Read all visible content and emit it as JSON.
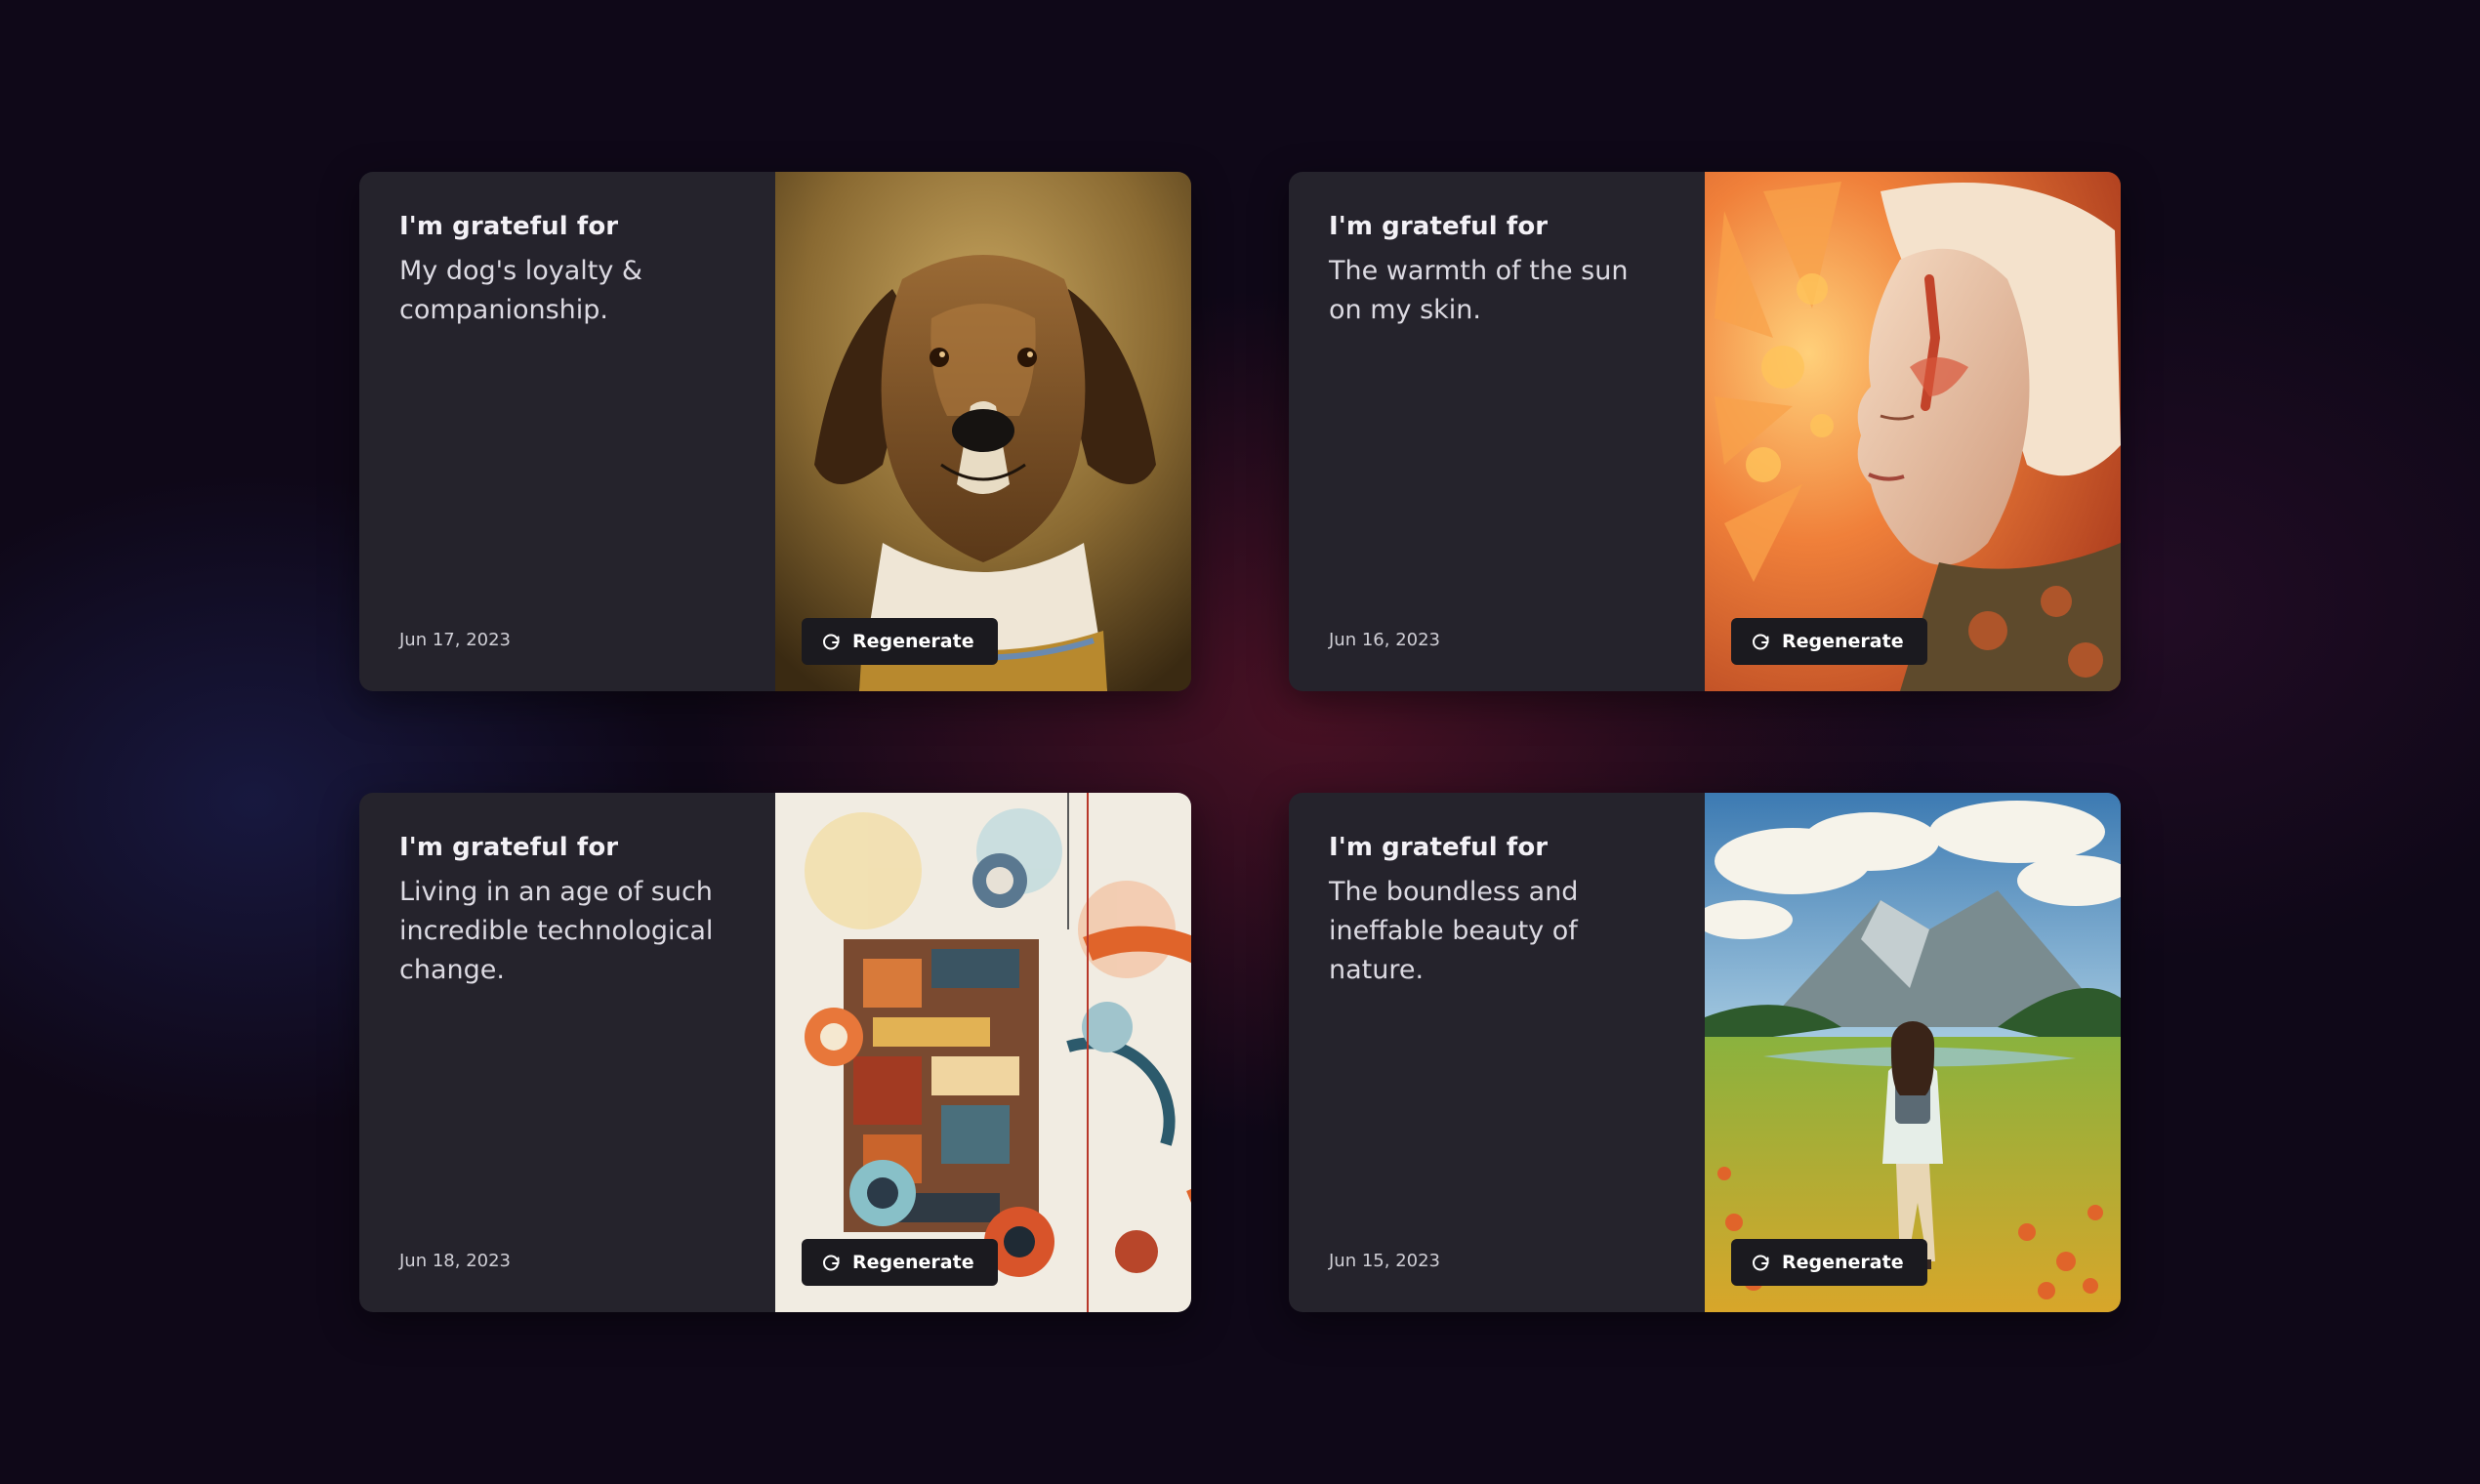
{
  "cards": [
    {
      "title": "I'm grateful for",
      "text": "My dog's loyalty & companionship.",
      "date": "Jun 17, 2023",
      "image_subject": "dog portrait",
      "button_label": "Regenerate",
      "button_icon": "refresh-icon"
    },
    {
      "title": "I'm grateful for",
      "text": "The warmth of the sun on my skin.",
      "date": "Jun 16, 2023",
      "image_subject": "face in sunlight",
      "button_label": "Regenerate",
      "button_icon": "refresh-icon"
    },
    {
      "title": "I'm grateful for",
      "text": "Living in an age of such incredible technological change.",
      "date": "Jun 18, 2023",
      "image_subject": "abstract technology collage",
      "button_label": "Regenerate",
      "button_icon": "refresh-icon"
    },
    {
      "title": "I'm grateful for",
      "text": "The boundless and ineffable beauty of nature.",
      "date": "Jun 15, 2023",
      "image_subject": "girl walking in a flowered mountain meadow",
      "button_label": "Regenerate",
      "button_icon": "refresh-icon"
    }
  ],
  "colors": {
    "background": "#0f0818",
    "card": "#25232c",
    "button": "#1b1a1f",
    "title_text": "#f3f1f6",
    "body_text": "#dcdae2"
  }
}
